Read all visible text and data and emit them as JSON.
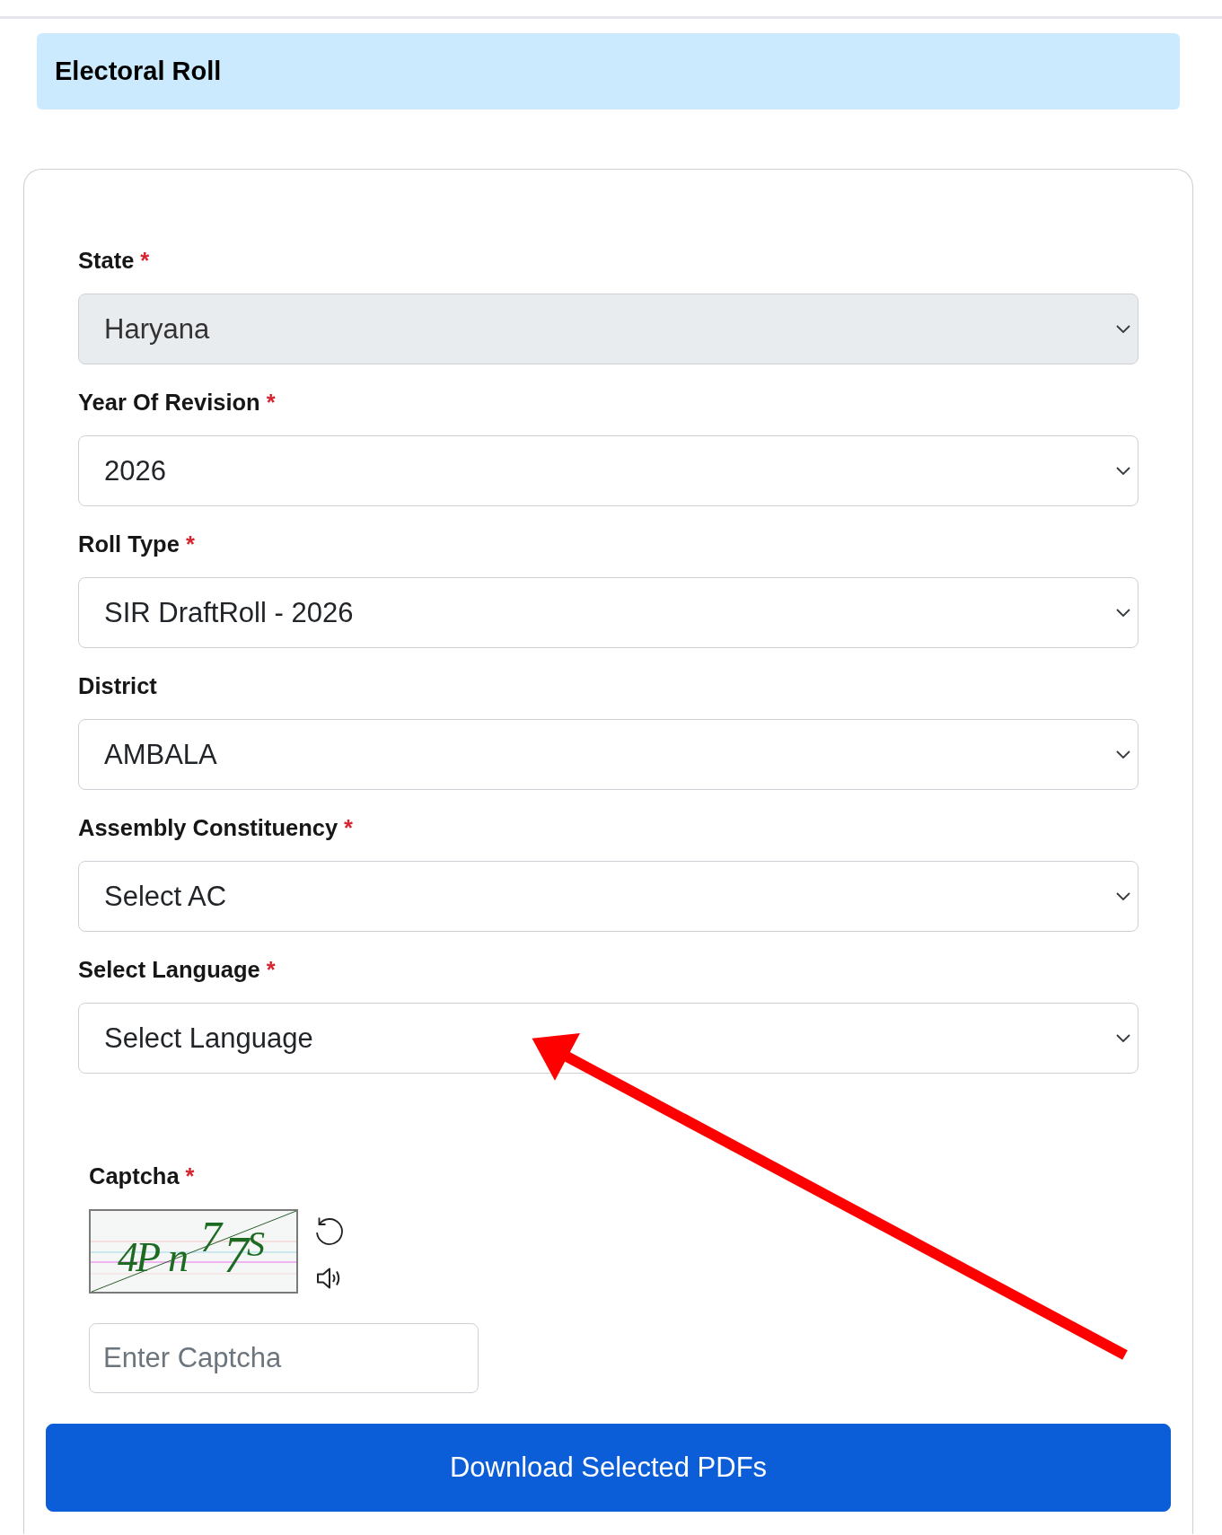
{
  "header": {
    "title": "Electoral Roll"
  },
  "form": {
    "fields": [
      {
        "label": "State",
        "required_mark": "*",
        "value": "Haryana",
        "disabled": true
      },
      {
        "label": "Year Of Revision",
        "required_mark": "*",
        "value": "2026",
        "disabled": false
      },
      {
        "label": "Roll Type",
        "required_mark": "*",
        "value": "SIR DraftRoll - 2026",
        "disabled": false
      },
      {
        "label": "District",
        "value": "AMBALA",
        "disabled": false
      },
      {
        "label": "Assembly Constituency",
        "required_mark": "*",
        "value": "Select AC",
        "disabled": false
      },
      {
        "label": "Select Language",
        "required_mark": "*",
        "value": "Select Language",
        "disabled": false
      }
    ],
    "captcha": {
      "label": "Captcha",
      "required_mark": "*",
      "image_text": "4Pn77S",
      "placeholder": "Enter Captcha"
    },
    "submit_button": "Download Selected PDFs"
  },
  "annotation": {
    "kind": "arrow"
  }
}
